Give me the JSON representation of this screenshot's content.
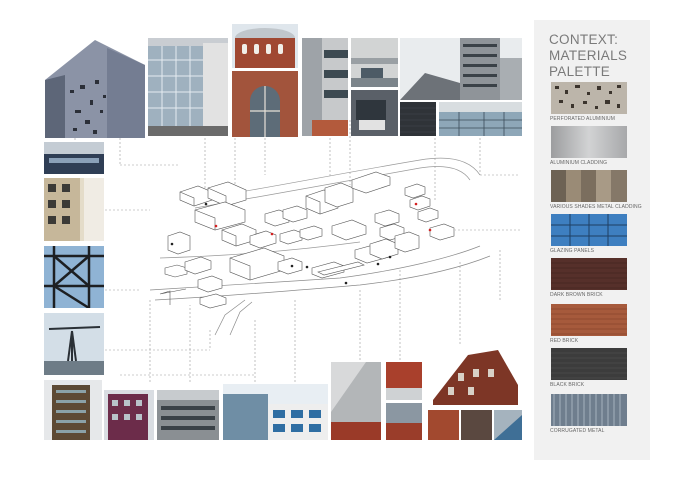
{
  "palette": {
    "title_lines": [
      "CONTEXT:",
      "MATERIALS",
      "PALETTE"
    ],
    "swatches": [
      {
        "label": "PERFORATED ALUMINIUM",
        "color": "#bcb5aa"
      },
      {
        "label": "ALUMINIUM CLADDING",
        "color": "#b9b9b9"
      },
      {
        "label": "VARIOUS SHADES METAL CLADDING",
        "color": "#8d7f6d"
      },
      {
        "label": "GLAZING PANELS",
        "color": "#3e7fc0"
      },
      {
        "label": "DARK BROWN BRICK",
        "color": "#56302a"
      },
      {
        "label": "RED BRICK",
        "color": "#a65a3c"
      },
      {
        "label": "BLACK BRICK",
        "color": "#3c3c3c"
      },
      {
        "label": "CORRUGATED METAL",
        "color": "#6f7e8e"
      }
    ]
  },
  "photos": {
    "top": [
      "perforated-facade-photo",
      "glazed-office-photo",
      "rotunda-photo",
      "grey-block-photo",
      "residential-tower-photo"
    ],
    "left": [
      "station-photo",
      "apartment-photo",
      "steel-frame-photo",
      "crane-photo"
    ],
    "bottom": [
      "brown-block-photo",
      "purple-block-photo",
      "grey-office-photo",
      "glass-office-photo",
      "angled-cladding-photo",
      "brick-terrace-photo"
    ]
  }
}
